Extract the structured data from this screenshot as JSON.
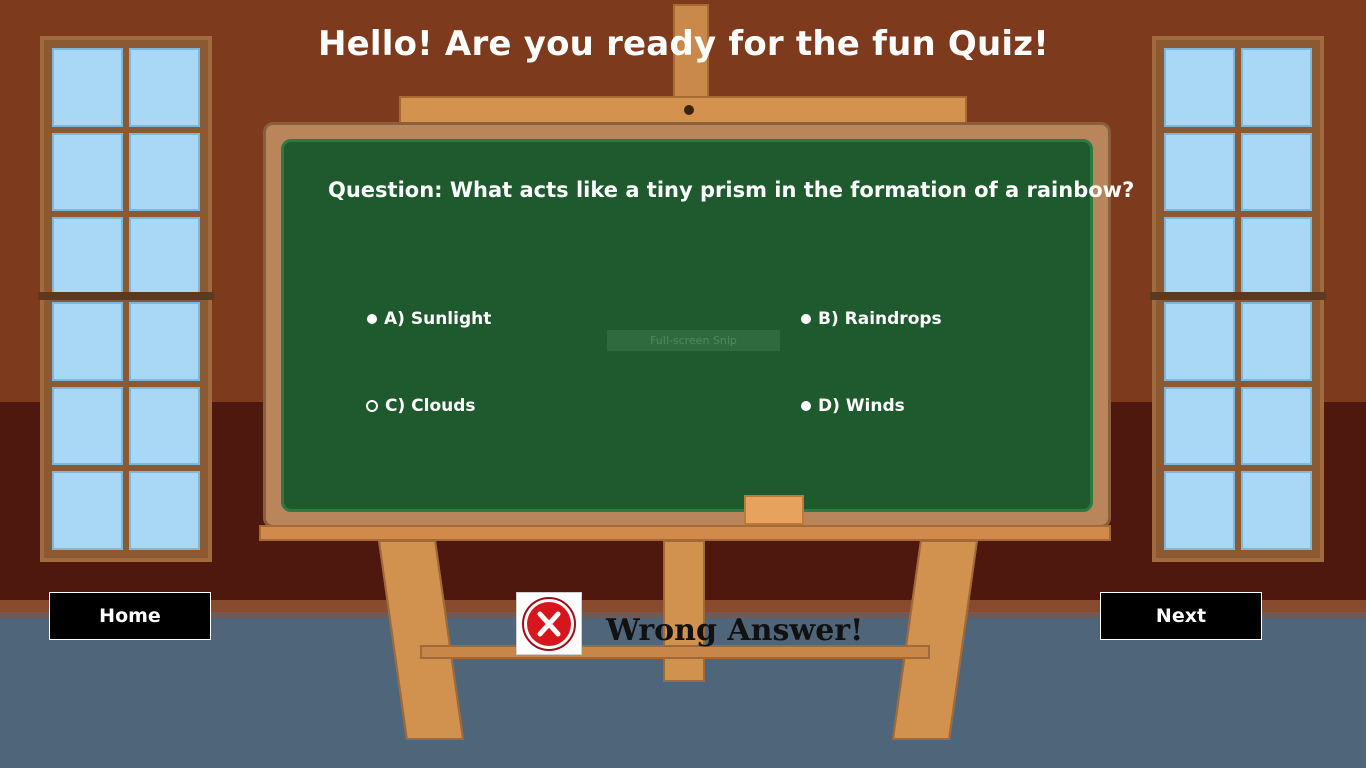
{
  "header": {
    "title": "Hello! Are you ready for the fun Quiz!"
  },
  "quiz": {
    "question": "Question: What acts like a tiny prism in the formation of a rainbow?",
    "options": [
      {
        "label": "A) Sunlight",
        "selected": false
      },
      {
        "label": "B) Raindrops",
        "selected": false
      },
      {
        "label": "C) Clouds",
        "selected": true
      },
      {
        "label": "D) Winds",
        "selected": false
      }
    ]
  },
  "overlay": {
    "snip_label": "Full-screen Snip"
  },
  "navigation": {
    "home_label": "Home",
    "next_label": "Next"
  },
  "result": {
    "text": "Wrong Answer!",
    "icon": "wrong-x-icon",
    "icon_color": "#d6161c"
  },
  "colors": {
    "board": "#1f5a2e",
    "wall": "#7d3a1c",
    "floor": "#4f6579",
    "button_bg": "#000000"
  }
}
